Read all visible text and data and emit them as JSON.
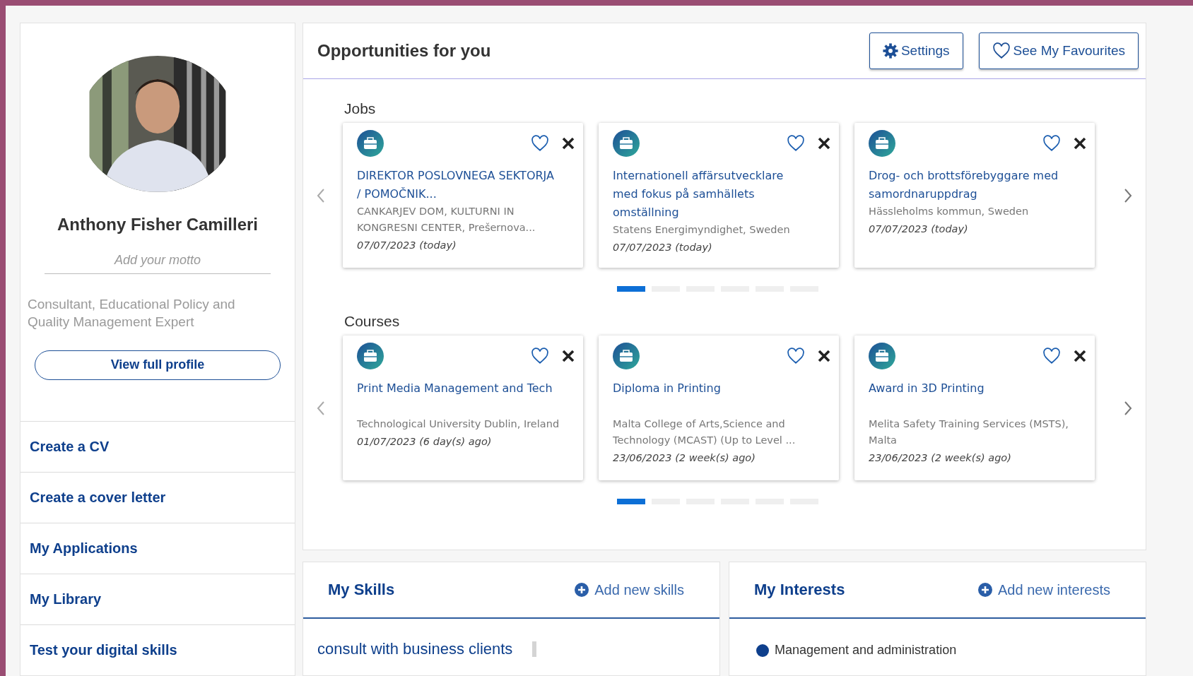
{
  "profile": {
    "name": "Anthony Fisher Camilleri",
    "motto_placeholder": "Add your motto",
    "description": "Consultant, Educational Policy and Quality Management Expert",
    "view_button": "View full profile"
  },
  "sidebar": {
    "items": [
      {
        "label": "Create a CV"
      },
      {
        "label": "Create a cover letter"
      },
      {
        "label": "My Applications"
      },
      {
        "label": "My Library"
      },
      {
        "label": "Test your digital skills"
      }
    ]
  },
  "opportunities": {
    "title": "Opportunities for you",
    "buttons": [
      {
        "kind": "settings",
        "label": "Settings"
      },
      {
        "kind": "favourites",
        "label": "See My Favourites"
      }
    ],
    "sections": [
      {
        "title": "Jobs",
        "cards": [
          {
            "title": "DIREKTOR POSLOVNEGA SEKTORJA / POMOČNIK...",
            "org": "CANKARJEV DOM, KULTURNI IN KONGRESNI CENTER, Prešernova...",
            "date": "07/07/2023 (today)"
          },
          {
            "title": "Internationell affärsutvecklare med fokus på samhällets omställning",
            "org": "Statens Energimyndighet, Sweden",
            "date": "07/07/2023 (today)"
          },
          {
            "title": "Drog- och brottsförebyggare med samordnaruppdrag",
            "org": "Hässleholms kommun, Sweden",
            "date": "07/07/2023 (today)"
          }
        ],
        "pages": [
          {
            "selected": true
          },
          {
            "selected": false
          },
          {
            "selected": false
          },
          {
            "selected": false
          },
          {
            "selected": false
          },
          {
            "selected": false
          }
        ]
      },
      {
        "title": "Courses",
        "cards": [
          {
            "title": "Print Media Management and Tech",
            "org": "Technological University Dublin, Ireland",
            "date": "01/07/2023 (6 day(s) ago)"
          },
          {
            "title": "Diploma in Printing",
            "org": "Malta College of Arts,Science and Technology (MCAST) (Up to Level ...",
            "date": "23/06/2023 (2 week(s) ago)"
          },
          {
            "title": "Award in 3D Printing",
            "org": "Melita Safety Training Services (MSTS), Malta",
            "date": "23/06/2023 (2 week(s) ago)"
          }
        ],
        "pages": [
          {
            "selected": true
          },
          {
            "selected": false
          },
          {
            "selected": false
          },
          {
            "selected": false
          },
          {
            "selected": false
          },
          {
            "selected": false
          }
        ]
      }
    ]
  },
  "skills": {
    "title": "My Skills",
    "add_label": "Add new skills",
    "items": [
      {
        "label": "consult with business clients"
      }
    ]
  },
  "interests": {
    "title": "My Interests",
    "add_label": "Add new interests",
    "items": [
      {
        "label": "Management and administration",
        "color": "#0e3f8c"
      }
    ]
  }
}
